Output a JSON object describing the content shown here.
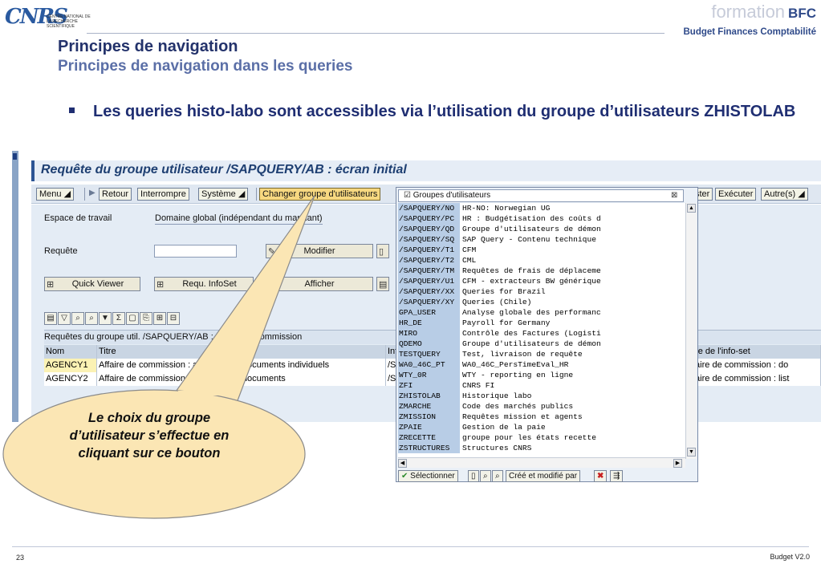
{
  "logos": {
    "cnrs_mark": "CNRS",
    "cnrs_subtitle": "CENTRE NATIONAL DE LA RECHERCHE SCIENTIFIQUE",
    "bfc_formation": "formation",
    "bfc_name": "BFC",
    "bfc_tagline": "Budget Finances Comptabilité"
  },
  "slide": {
    "title": "Principes de navigation",
    "subtitle": "Principes de navigation dans les queries",
    "bullet": "Les queries histo-labo sont accessibles via l’utilisation du groupe d’utilisateurs ZHISTOLAB",
    "callout": "Le choix du groupe d’utilisateur s’effectue en cliquant sur ce bouton",
    "page_number": "23",
    "footer_version": "Budget  V2.0"
  },
  "sap": {
    "title": "Requête du groupe utilisateur /SAPQUERY/AB : écran initial",
    "toolbar": {
      "menu": "Menu",
      "retour": "Retour",
      "interrompre": "Interrompre",
      "systeme": "Système",
      "changer_groupe": "Changer groupe d'utilisateurs",
      "ster": "ster",
      "executer": "Exécuter",
      "autres": "Autre(s)"
    },
    "form": {
      "espace_label": "Espace de travail",
      "espace_value": "Domaine global (indépendant du mandant)",
      "requete_label": "Requête",
      "modifier": "Modifier",
      "afficher": "Afficher",
      "quick_viewer": "Quick Viewer",
      "requ_infoset": "Requ. InfoSet"
    },
    "grid": {
      "caption": "Requêtes du groupe util. /SAPQUERY/AB : Affaire de commission",
      "headers": [
        "Nom",
        "Titre",
        "Inf",
        "tre de l'info-set"
      ],
      "rows": [
        [
          "AGENCY1",
          "Affaire de commission : analyse des documents individuels",
          "/S",
          "faire de commission : do"
        ],
        [
          "AGENCY2",
          "Affaire de commission : analyse des documents",
          "/S",
          "faire de commission : list"
        ]
      ]
    }
  },
  "popup": {
    "input_value": "Groupes d'utilisateurs",
    "items": [
      {
        "key": "/SAPQUERY/NO",
        "value": "HR-NO: Norwegian UG"
      },
      {
        "key": "/SAPQUERY/PC",
        "value": "HR : Budgétisation des coûts d"
      },
      {
        "key": "/SAPQUERY/QD",
        "value": "Groupe d'utilisateurs de démon"
      },
      {
        "key": "/SAPQUERY/SQ",
        "value": "SAP Query - Contenu technique"
      },
      {
        "key": "/SAPQUERY/T1",
        "value": "CFM"
      },
      {
        "key": "/SAPQUERY/T2",
        "value": "CML"
      },
      {
        "key": "/SAPQUERY/TM",
        "value": "Requêtes de frais de déplaceme"
      },
      {
        "key": "/SAPQUERY/U1",
        "value": "CFM - extracteurs BW générique"
      },
      {
        "key": "/SAPQUERY/XX",
        "value": "Queries for Brazil"
      },
      {
        "key": "/SAPQUERY/XY",
        "value": "Queries (Chile)"
      },
      {
        "key": "GPA_USER",
        "value": "Analyse globale des performanc"
      },
      {
        "key": "HR_DE",
        "value": "Payroll for Germany"
      },
      {
        "key": "MIRO",
        "value": "Contrôle des Factures (Logisti"
      },
      {
        "key": "QDEMO",
        "value": "Groupe d'utilisateurs de démon"
      },
      {
        "key": "TESTQUERY",
        "value": "Test, livraison de requête"
      },
      {
        "key": "WA0_46C_PT",
        "value": "WA0_46C_PersTimeEval_HR"
      },
      {
        "key": "WTY_0R",
        "value": "WTY - reporting en ligne"
      },
      {
        "key": "ZFI",
        "value": "CNRS FI"
      },
      {
        "key": "ZHISTOLAB",
        "value": "Historique labo"
      },
      {
        "key": "ZMARCHE",
        "value": "Code des marchés publics"
      },
      {
        "key": "ZMISSION",
        "value": "Requêtes mission et agents"
      },
      {
        "key": "ZPAIE",
        "value": "Gestion de la paie"
      },
      {
        "key": "ZRECETTE",
        "value": "groupe pour les états recette"
      },
      {
        "key": "ZSTRUCTURES",
        "value": "Structures CNRS"
      }
    ],
    "select_button": "Sélectionner",
    "cree_button": "Créé et modifié par"
  }
}
